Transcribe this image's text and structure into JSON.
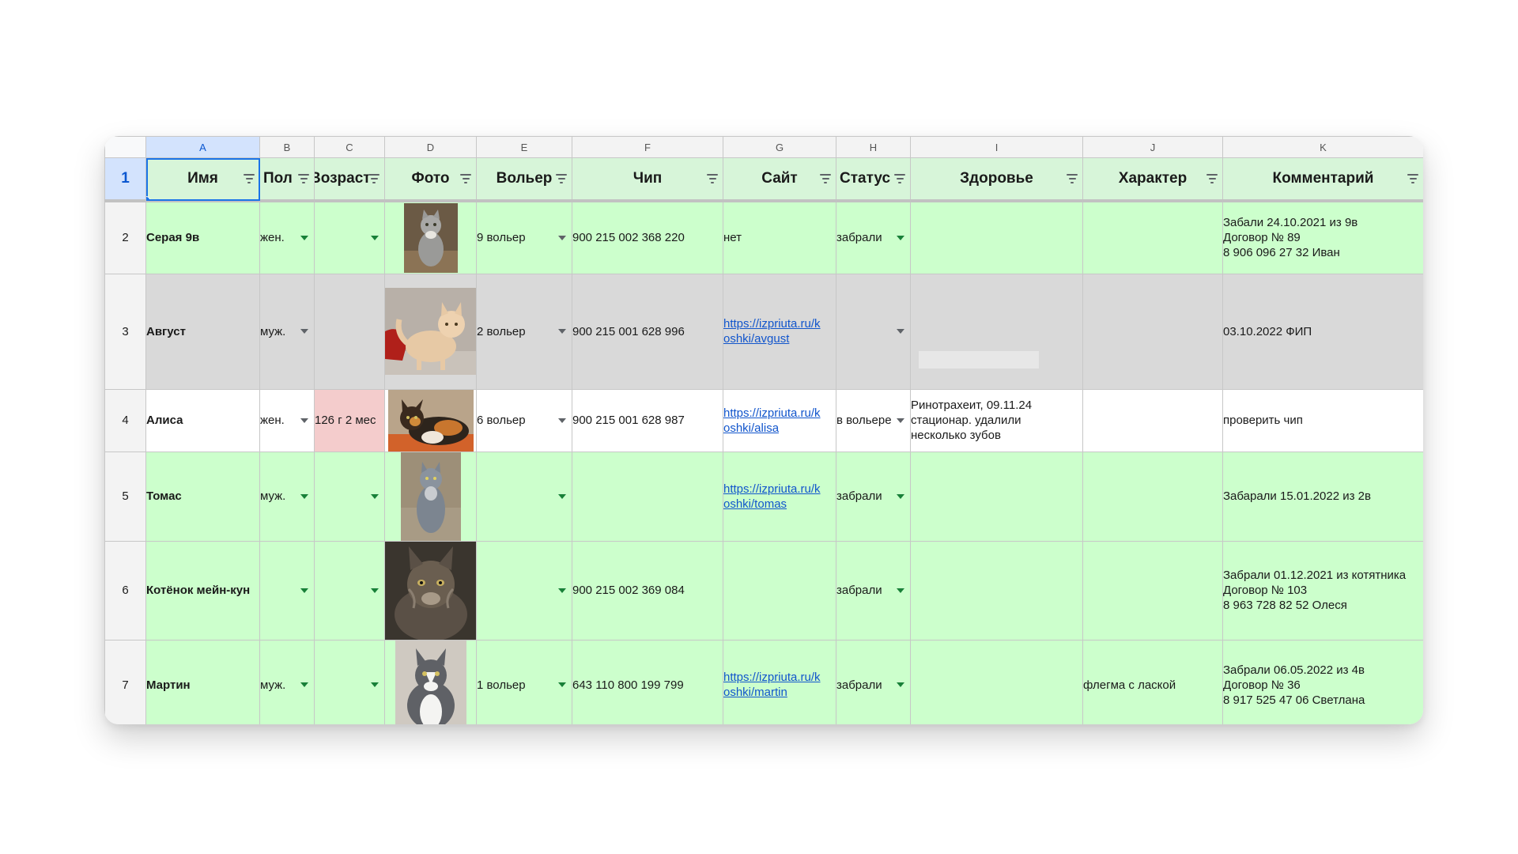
{
  "columns": [
    "A",
    "B",
    "C",
    "D",
    "E",
    "F",
    "G",
    "H",
    "I",
    "J",
    "K"
  ],
  "headers": {
    "name": "Имя",
    "sex": "Пол",
    "age": "Возраст",
    "photo": "Фото",
    "enclosure": "Вольер",
    "chip": "Чип",
    "site": "Сайт",
    "status": "Статус",
    "health": "Здоровье",
    "character": "Характер",
    "comment": "Комментарий"
  },
  "rows": [
    {
      "num": "1"
    },
    {
      "num": "2",
      "name": "Серая 9в",
      "sex": "жен.",
      "age": "",
      "photo_icon": "gray-cat-photo",
      "enclosure": "9 вольер",
      "chip": "900 215 002 368 220",
      "site": "нет",
      "site_link": "",
      "status": "забрали",
      "health": "",
      "character": "",
      "comment": "Забали 24.10.2021 из 9в\nДоговор № 89\n8 906 096 27 32 Иван",
      "color": "#ccffcc"
    },
    {
      "num": "3",
      "name": "Август",
      "sex": "муж.",
      "age": "",
      "photo_icon": "cream-cat-photo",
      "enclosure": "2 вольер",
      "chip": "900 215 001 628 996",
      "site": "",
      "site_link": "https://izpriuta.ru/koshki/avgust",
      "status": "",
      "health": "",
      "character": "",
      "comment": "03.10.2022 ФИП",
      "color": "#d9d9d9"
    },
    {
      "num": "4",
      "name": "Алиса",
      "sex": "жен.",
      "age": "126 г 2 мес",
      "photo_icon": "calico-cat-photo",
      "enclosure": "6 вольер",
      "chip": "900 215 001 628 987",
      "site": "",
      "site_link": "https://izpriuta.ru/koshki/alisa",
      "status": "в вольере",
      "health": "Ринотрахеит, 09.11.24\nстационар. удалили\nнесколько зубов",
      "character": "",
      "comment": "проверить чип",
      "color": "#ffffff"
    },
    {
      "num": "5",
      "name": "Томас",
      "sex": "муж.",
      "age": "",
      "photo_icon": "blue-gray-cat-photo",
      "enclosure": "",
      "chip": "",
      "site": "",
      "site_link": "https://izpriuta.ru/koshki/tomas",
      "status": "забрали",
      "health": "",
      "character": "",
      "comment": "Забарали 15.01.2022 из 2в",
      "color": "#ccffcc"
    },
    {
      "num": "6",
      "name": "Котёнок мейн-кун",
      "sex": "",
      "age": "",
      "photo_icon": "maine-coon-kitten-photo",
      "enclosure": "",
      "chip": "900 215 002 369 084",
      "site": "",
      "site_link": "",
      "status": "забрали",
      "health": "",
      "character": "",
      "comment": "Забрали 01.12.2021 из котятника\nДоговор № 103\n8 963 728 82 52 Олеся",
      "color": "#ccffcc"
    },
    {
      "num": "7",
      "name": "Мартин",
      "sex": "муж.",
      "age": "",
      "photo_icon": "gray-white-cat-photo",
      "enclosure": "1 вольер",
      "chip": "643 110 800 199 799",
      "site": "",
      "site_link": "https://izpriuta.ru/koshki/martin",
      "status": "забрали",
      "health": "",
      "character": "флегма с лаской",
      "comment": "Забрали 06.05.2022 из 4в\nДоговор № 36\n8 917 525 47 06 Светлана",
      "color": "#ccffcc"
    }
  ],
  "link_display": {
    "avgust": [
      "https://izpriuta.ru/k",
      "oshki/avgust"
    ],
    "alisa": [
      "https://izpriuta.ru/k",
      "oshki/alisa"
    ],
    "tomas": [
      "https://izpriuta.ru/k",
      "oshki/tomas"
    ],
    "martin": [
      "https://izpriuta.ru/k",
      "oshki/martin"
    ]
  },
  "colors": {
    "header_bg": "#d7f5d9",
    "green_row": "#ccffcc",
    "gray_row": "#d9d9d9",
    "pink_cell": "#f4cccc",
    "link": "#1155cc",
    "selection": "#1a73e8"
  }
}
